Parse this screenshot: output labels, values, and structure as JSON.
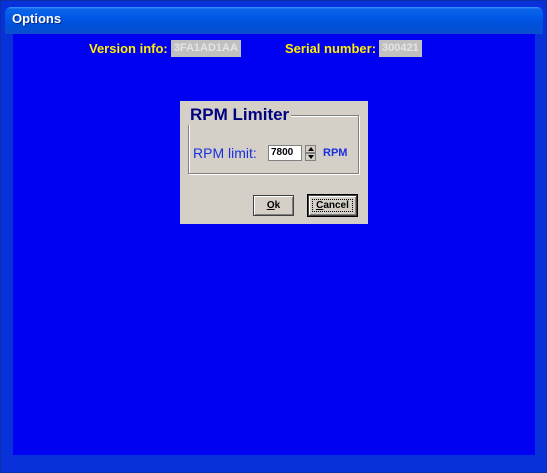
{
  "window": {
    "title": "Options",
    "colors": {
      "client_background": "#0000f3",
      "titlebar": "#0058e6",
      "info_label": "#ffee00"
    }
  },
  "header": {
    "version_label": "Version info:",
    "version_value": "3FA1AD1AA",
    "serial_label": "Serial number:",
    "serial_value": "300421"
  },
  "dialog": {
    "title": "RPM Limiter",
    "rpm_label": "RPM limit:",
    "rpm_value": "7800",
    "rpm_unit": "RPM",
    "ok_label": "Ok",
    "ok_rest": "k",
    "ok_underline": "O",
    "cancel_underline": "C",
    "cancel_rest": "ancel"
  }
}
